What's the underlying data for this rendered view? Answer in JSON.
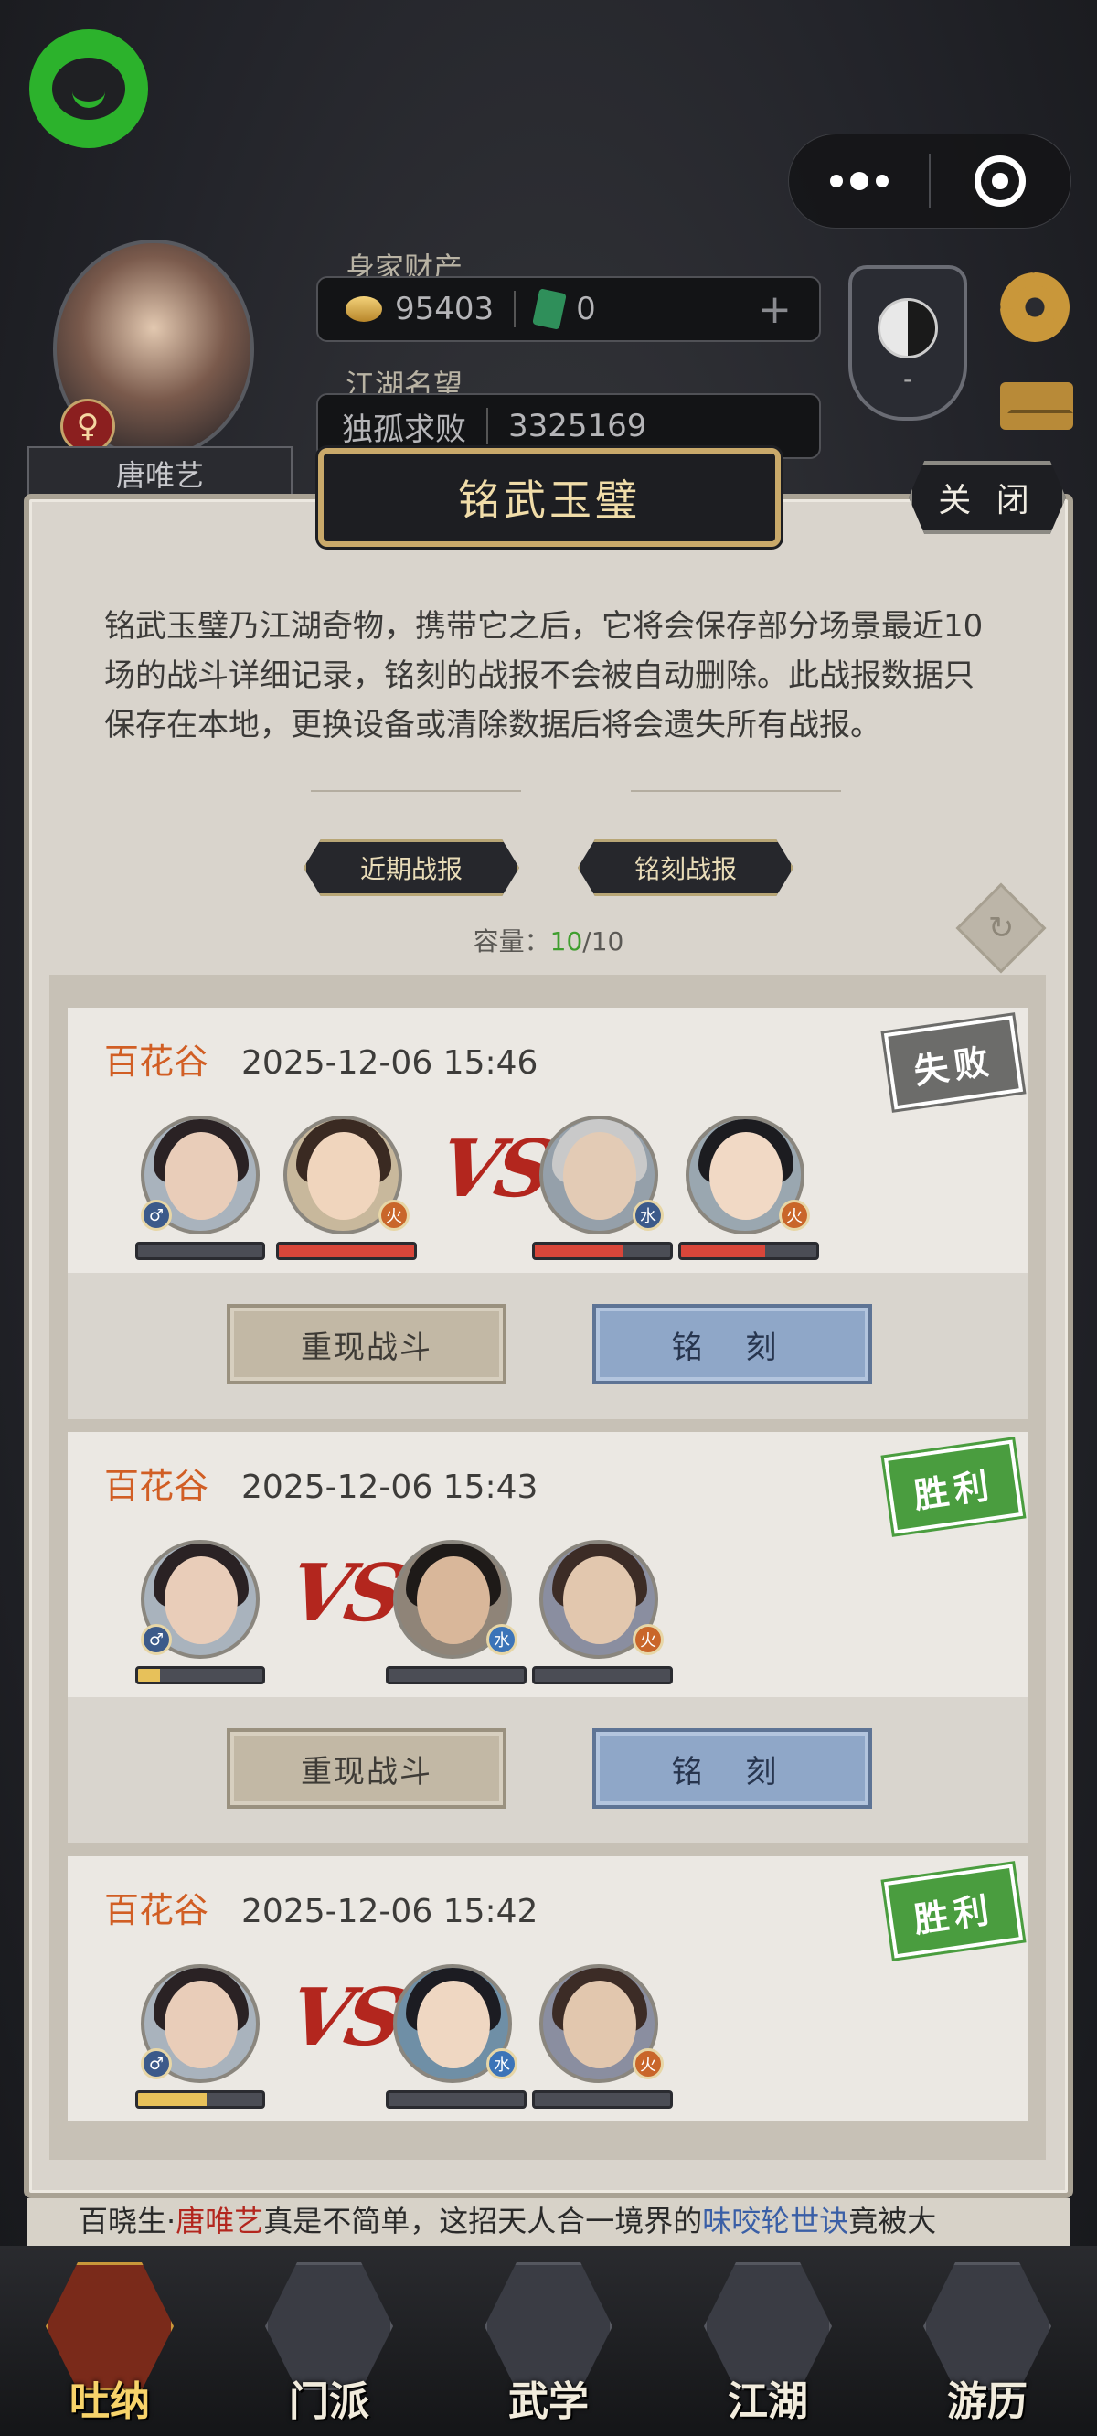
{
  "top_bar": {
    "wealth_label": "身家财产",
    "silver": "95403",
    "jade": "0",
    "fame_label": "江湖名望",
    "fame_title": "独孤求败",
    "fame_value": "3325169",
    "player_name": "唐唯艺",
    "gender": "♀",
    "taiji_value": "-"
  },
  "dialog": {
    "title": "铭武玉璧",
    "close_label": "关 闭",
    "description": "铭武玉璧乃江湖奇物，携带它之后，它将会保存部分场景最近10场的战斗详细记录，铭刻的战报不会被自动删除。此战报数据只保存在本地，更换设备或清除数据后将会遗失所有战报。",
    "tabs": [
      "近期战报",
      "铭刻战报"
    ],
    "capacity_label": "容量：",
    "capacity_used": "10",
    "capacity_total": "/10"
  },
  "records": [
    {
      "place": "百花谷",
      "time": "2025-12-06 15:46",
      "result": "失败",
      "left_hp": [
        0.0,
        1.0
      ],
      "right_hp": [
        0.65,
        0.62
      ],
      "replay_label": "重现战斗",
      "engrave_label": "铭 刻"
    },
    {
      "place": "百花谷",
      "time": "2025-12-06 15:43",
      "result": "胜利",
      "left_hp": [
        0.18
      ],
      "right_hp": [
        0.0,
        0.0
      ],
      "replay_label": "重现战斗",
      "engrave_label": "铭 刻"
    },
    {
      "place": "百花谷",
      "time": "2025-12-06 15:42",
      "result": "胜利",
      "left_hp": [
        0.55
      ],
      "right_hp": [
        0.0,
        0.0
      ]
    }
  ],
  "vs_label": "VS",
  "ticker": {
    "prefix": "百晓生·",
    "name": "唐唯艺",
    "middle": "真是不简单，这招天人合一境界的",
    "skill": "味咬轮世诀",
    "suffix": "竟被大"
  },
  "bottom_nav": [
    "吐纳",
    "门派",
    "武学",
    "江湖",
    "游历"
  ],
  "colors": {
    "place": "#d15e24",
    "hp_red": "#d9463a",
    "hp_gold": "#e7c15a",
    "win": "#4a9d3f",
    "lose": "#6c6c6a"
  }
}
